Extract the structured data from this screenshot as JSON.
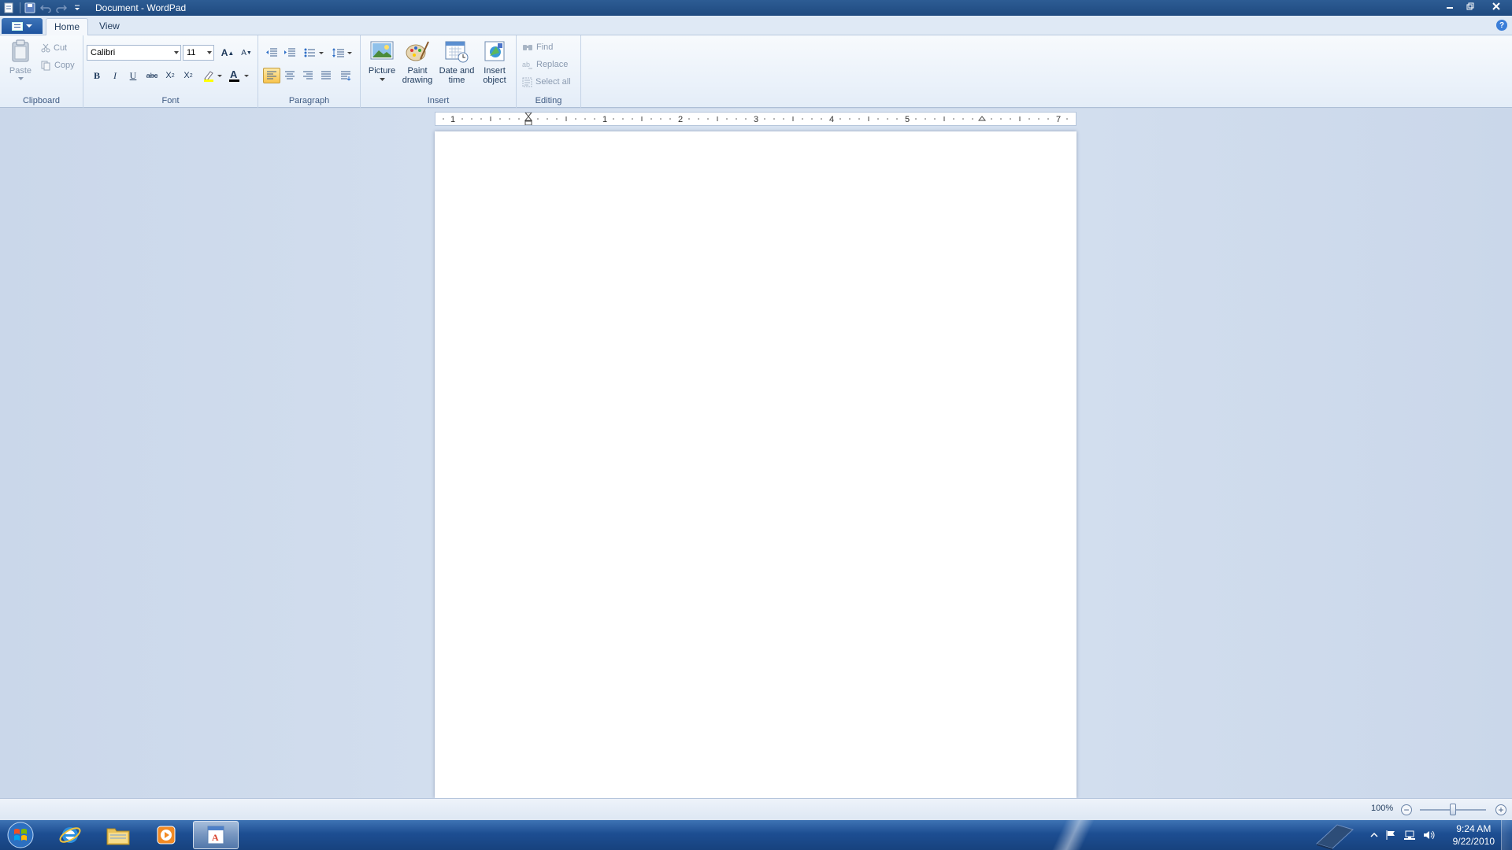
{
  "window": {
    "title": "Document - WordPad"
  },
  "tabs": {
    "home": "Home",
    "view": "View"
  },
  "help": "?",
  "clipboard": {
    "label": "Clipboard",
    "paste": "Paste",
    "cut": "Cut",
    "copy": "Copy"
  },
  "font": {
    "label": "Font",
    "family": "Calibri",
    "size": "11",
    "grow": "A",
    "shrink": "A",
    "bold": "B",
    "italic": "I",
    "underline": "U",
    "strike": "abc",
    "subscript": "X",
    "superscript": "X",
    "color_letter": "A"
  },
  "paragraph": {
    "label": "Paragraph"
  },
  "insert": {
    "label": "Insert",
    "picture": "Picture",
    "paint_line1": "Paint",
    "paint_line2": "drawing",
    "datetime_line1": "Date and",
    "datetime_line2": "time",
    "object_line1": "Insert",
    "object_line2": "object"
  },
  "editing": {
    "label": "Editing",
    "find": "Find",
    "replace": "Replace",
    "select_all": "Select all"
  },
  "ruler": {
    "numbers": [
      "1",
      "1",
      "2",
      "3",
      "4",
      "5",
      "7"
    ]
  },
  "status": {
    "zoom": "100%",
    "zoom_out": "−",
    "zoom_in": "+",
    "zoom_level": 0.5
  },
  "taskbar": {
    "time": "9:24 AM",
    "date": "9/22/2010"
  },
  "colors": {
    "accent": "#1f4a7f",
    "taskbar": "#1d4e92",
    "font_color": "#ff0000",
    "highlight": "#ffff00"
  },
  "icons": [
    "save-icon",
    "undo-icon",
    "redo-icon",
    "customize-icon",
    "minimize-icon",
    "maximize-icon",
    "close-icon",
    "paste-icon",
    "cut-icon",
    "copy-icon",
    "picture-icon",
    "paint-icon",
    "calendar-icon",
    "object-icon",
    "find-icon",
    "replace-icon",
    "select-all-icon",
    "windows-start-icon",
    "ie-icon",
    "folder-icon",
    "media-player-icon",
    "wordpad-icon",
    "flag-icon",
    "network-icon",
    "speaker-icon"
  ]
}
